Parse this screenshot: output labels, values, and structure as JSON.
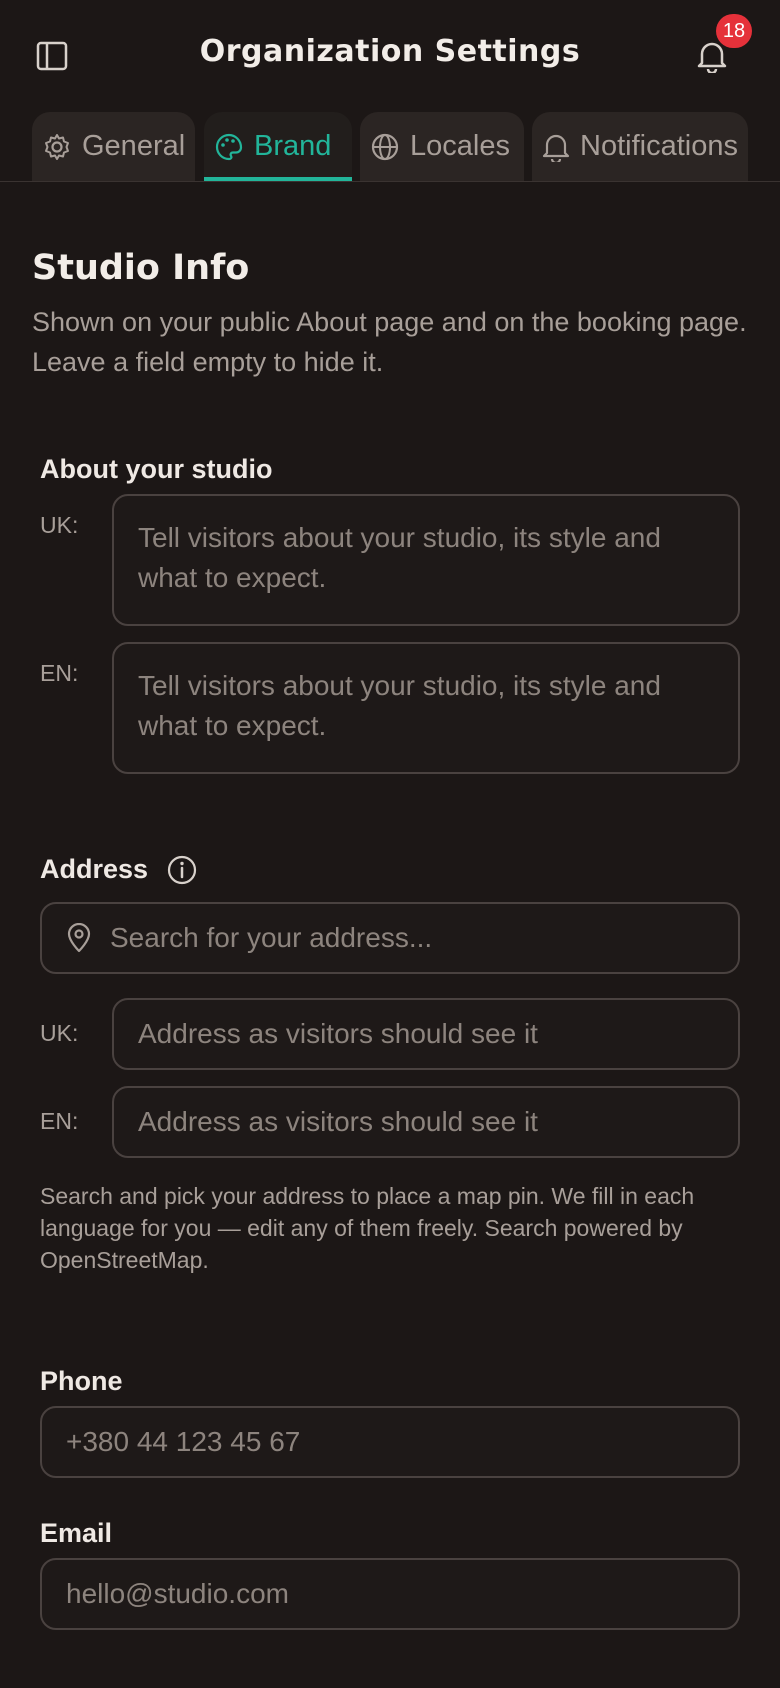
{
  "header": {
    "title": "Organization Settings",
    "notification_count": "18",
    "sidebar_icon": "sidebar-panel-icon",
    "bell_icon": "bell-icon"
  },
  "tabs": [
    {
      "label": "General",
      "icon": "gear-icon",
      "active": false
    },
    {
      "label": "Brand",
      "icon": "palette-icon",
      "active": true
    },
    {
      "label": "Locales",
      "icon": "globe-icon",
      "active": false
    },
    {
      "label": "Notifications",
      "icon": "bell-icon",
      "active": false
    }
  ],
  "section": {
    "title": "Studio Info",
    "description": "Shown on your public About page and on the booking page. Leave a field empty to hide it."
  },
  "about": {
    "label": "About your studio",
    "uk_label": "UK:",
    "uk_placeholder": "Tell visitors about your studio, its style and what to expect.",
    "en_label": "EN:",
    "en_placeholder": "Tell visitors about your studio, its style and what to expect."
  },
  "address": {
    "label": "Address",
    "search_placeholder": "Search for your address...",
    "uk_label": "UK:",
    "uk_placeholder": "Address as visitors should see it",
    "en_label": "EN:",
    "en_placeholder": "Address as visitors should see it",
    "help": "Search and pick your address to place a map pin. We fill in each language for you — edit any of them freely. Search powered by OpenStreetMap."
  },
  "phone": {
    "label": "Phone",
    "placeholder": "+380 44 123 45 67"
  },
  "email": {
    "label": "Email",
    "placeholder": "hello@studio.com"
  },
  "colors": {
    "background": "#1c1716",
    "accent": "#22b59a",
    "badge": "#e5313a"
  }
}
